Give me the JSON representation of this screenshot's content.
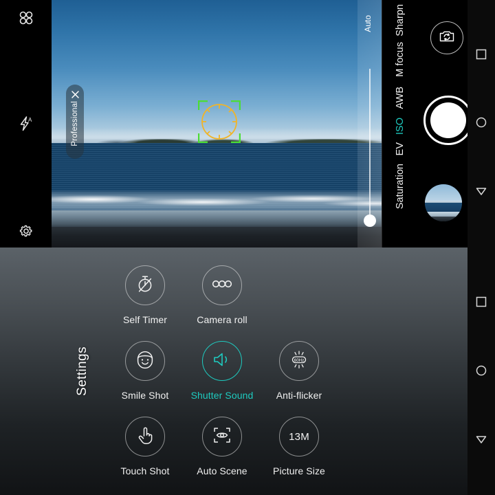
{
  "camera": {
    "left_rail": [
      {
        "name": "modes-icon",
        "label": "Modes"
      },
      {
        "name": "flash-auto-icon",
        "label": "Flash Auto"
      },
      {
        "name": "settings-gear-icon",
        "label": "Settings"
      }
    ],
    "mode_pill": {
      "label": "Professional",
      "close": "✕"
    },
    "slider": {
      "label": "Auto",
      "value_position_pct": 89
    },
    "pro_params": [
      {
        "label": "Sharpn",
        "active": false
      },
      {
        "label": "M focus",
        "active": false
      },
      {
        "label": "AWB",
        "active": false
      },
      {
        "label": "ISO",
        "active": true
      },
      {
        "label": "EV",
        "active": false
      },
      {
        "label": "Saturation",
        "active": false
      }
    ],
    "controls": {
      "switch_camera": "switch-camera-icon",
      "shutter": "shutter-button",
      "thumbnail": "gallery-thumbnail"
    },
    "focus": {
      "bracket_color": "#4cdd34",
      "ring_color": "#f0b429"
    }
  },
  "navbar": {
    "buttons": [
      {
        "name": "nav-recents-button",
        "glyph": "square"
      },
      {
        "name": "nav-home-button",
        "glyph": "circle"
      },
      {
        "name": "nav-back-button",
        "glyph": "triangle"
      }
    ]
  },
  "settings": {
    "title": "Settings",
    "accent_color": "#1ecbc0",
    "tiles": [
      {
        "label": "Self Timer",
        "icon": "timer-off-icon",
        "active": false,
        "value": ""
      },
      {
        "label": "Camera roll",
        "icon": "burst-dots-icon",
        "active": false,
        "value": ""
      },
      {
        "label": "Smile Shot",
        "icon": "smile-face-icon",
        "active": false,
        "value": ""
      },
      {
        "label": "Shutter Sound",
        "icon": "speaker-icon",
        "active": true,
        "value": ""
      },
      {
        "label": "Anti-flicker",
        "icon": "flicker-60hz-icon",
        "active": false,
        "value": "60Hz"
      },
      {
        "label": "Touch Shot",
        "icon": "touch-hand-icon",
        "active": false,
        "value": ""
      },
      {
        "label": "Auto Scene",
        "icon": "scene-eye-icon",
        "active": false,
        "value": ""
      },
      {
        "label": "Picture Size",
        "icon": "picture-size-icon",
        "active": false,
        "value": "13M"
      }
    ]
  }
}
